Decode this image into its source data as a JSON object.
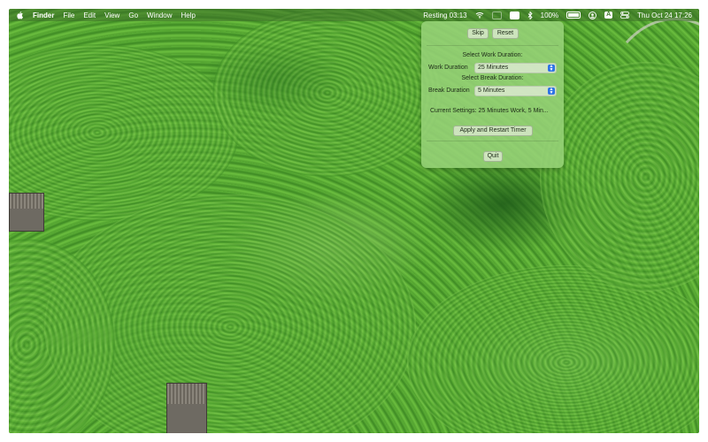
{
  "menubar": {
    "app_name": "Finder",
    "menus": [
      "File",
      "Edit",
      "View",
      "Go",
      "Window",
      "Help"
    ],
    "status_timer": "Resting 03:13",
    "battery_percent": "100%",
    "input_source": "A",
    "datetime": "Thu Oct 24  17:26"
  },
  "panel": {
    "skip_label": "Skip",
    "reset_label": "Reset",
    "select_work_heading": "Select Work Duration:",
    "work_label": "Work Duration",
    "work_value": "25 Minutes",
    "select_break_heading": "Select Break Duration:",
    "break_label": "Break Duration",
    "break_value": "5 Minutes",
    "current_settings": "Current Settings: 25 Minutes Work, 5 Min...",
    "apply_label": "Apply and Restart Timer",
    "quit_label": "Quit"
  },
  "icons": [
    "apple-icon",
    "wifi-icon",
    "window-icon",
    "screenshot-icon",
    "bluetooth-icon",
    "battery-icon",
    "user-icon",
    "control-center-icon"
  ]
}
